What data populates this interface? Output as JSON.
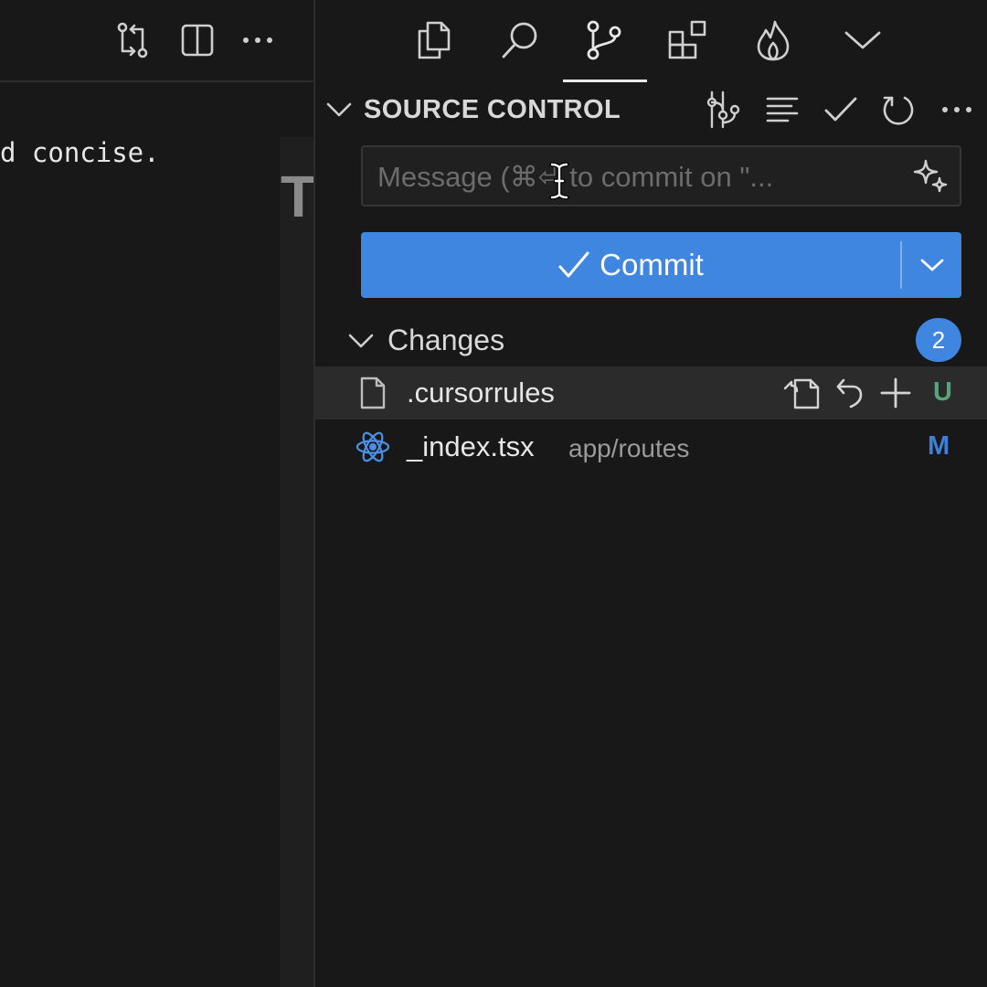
{
  "editor": {
    "code_line": "d concise.",
    "minimap_glyph": "T",
    "toolbar": {
      "actions": [
        "compare-changes-icon",
        "split-editor-icon",
        "more-actions-icon"
      ]
    }
  },
  "activity_bar": {
    "items": [
      "explorer-icon",
      "search-icon",
      "source-control-icon",
      "extensions-icon",
      "flame-icon",
      "chevron-down-icon"
    ],
    "active": "source-control-icon"
  },
  "scm": {
    "title": "SOURCE CONTROL",
    "header_actions": [
      "graph-icon",
      "list-view-icon",
      "checkmark-icon",
      "refresh-icon",
      "more-actions-icon"
    ],
    "message_placeholder": "Message (⌘⏎ to commit on \"...",
    "commit_label": "Commit",
    "changes_label": "Changes",
    "changes_count": "2",
    "files": [
      {
        "name": ".cursorrules",
        "path": "",
        "status": "U",
        "status_color": "#57a37a",
        "icon": "file-icon",
        "selected": true
      },
      {
        "name": "_index.tsx",
        "path": "app/routes",
        "status": "M",
        "status_color": "#3f7fd6",
        "icon": "react-icon",
        "selected": false
      }
    ]
  },
  "colors": {
    "accent": "#3f86e0",
    "background": "#181818",
    "selected_row": "#2b2b2b"
  }
}
